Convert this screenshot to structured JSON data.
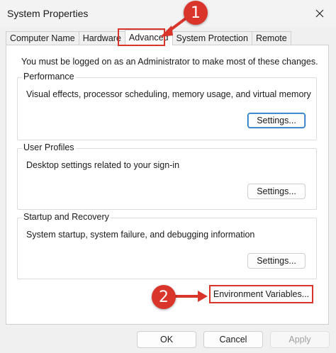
{
  "window": {
    "title": "System Properties"
  },
  "tabs": [
    {
      "label": "Computer Name"
    },
    {
      "label": "Hardware"
    },
    {
      "label": "Advanced"
    },
    {
      "label": "System Protection"
    },
    {
      "label": "Remote"
    }
  ],
  "intro": "You must be logged on as an Administrator to make most of these changes.",
  "groups": {
    "performance": {
      "title": "Performance",
      "desc": "Visual effects, processor scheduling, memory usage, and virtual memory",
      "button": "Settings..."
    },
    "profiles": {
      "title": "User Profiles",
      "desc": "Desktop settings related to your sign-in",
      "button": "Settings..."
    },
    "startup": {
      "title": "Startup and Recovery",
      "desc": "System startup, system failure, and debugging information",
      "button": "Settings..."
    }
  },
  "env_button": "Environment Variables...",
  "footer": {
    "ok": "OK",
    "cancel": "Cancel",
    "apply": "Apply"
  },
  "annotations": {
    "step1": "1",
    "step2": "2"
  },
  "colors": {
    "annotation_red": "#d9352b",
    "focus_blue": "#0f6cbd"
  }
}
